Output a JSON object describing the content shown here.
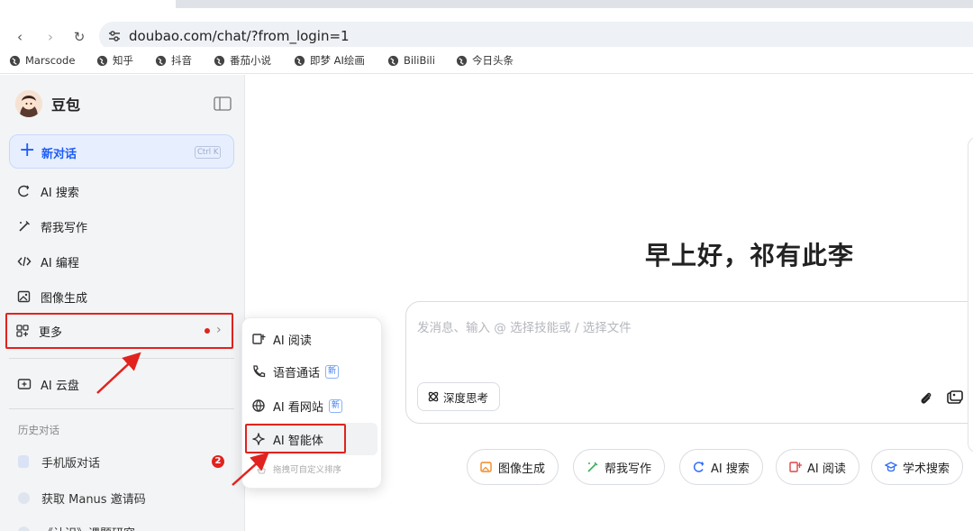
{
  "browser": {
    "url": "doubao.com/chat/?from_login=1",
    "bookmarks": [
      "Marscode",
      "知乎",
      "抖音",
      "番茄小说",
      "即梦 AI绘画",
      "BiliBili",
      "今日头条"
    ]
  },
  "sidebar": {
    "brand": "豆包",
    "new_chat": {
      "label": "新对话",
      "shortcut": "Ctrl K"
    },
    "items": [
      {
        "label": "AI 搜索",
        "icon": "ai-search-icon"
      },
      {
        "label": "帮我写作",
        "icon": "pen-icon"
      },
      {
        "label": "AI 编程",
        "icon": "code-icon"
      },
      {
        "label": "图像生成",
        "icon": "image-icon"
      },
      {
        "label": "更多",
        "icon": "grid-icon"
      },
      {
        "label": "AI 云盘",
        "icon": "cloud-drive-icon"
      }
    ],
    "history_title": "历史对话",
    "history": [
      {
        "label": "手机版对话",
        "badge": "2"
      },
      {
        "label": "获取 Manus 邀请码"
      },
      {
        "label": "《认识》课题研究"
      }
    ]
  },
  "more_menu": {
    "items": [
      {
        "label": "AI 阅读",
        "new": ""
      },
      {
        "label": "语音通话",
        "new": "新"
      },
      {
        "label": "AI 看网站",
        "new": "新"
      },
      {
        "label": "AI 智能体",
        "new": ""
      }
    ],
    "hint": "拖拽可自定义排序"
  },
  "main": {
    "greeting": "早上好，祁有此李",
    "input_placeholder": "发消息、输入 @ 选择技能或 / 选择文件",
    "deep_think": "深度思考",
    "chips": [
      "图像生成",
      "帮我写作",
      "AI 搜索",
      "AI 阅读",
      "学术搜索"
    ]
  },
  "colors": {
    "accent": "#1d5cf5",
    "annotation_red": "#e0231e"
  }
}
